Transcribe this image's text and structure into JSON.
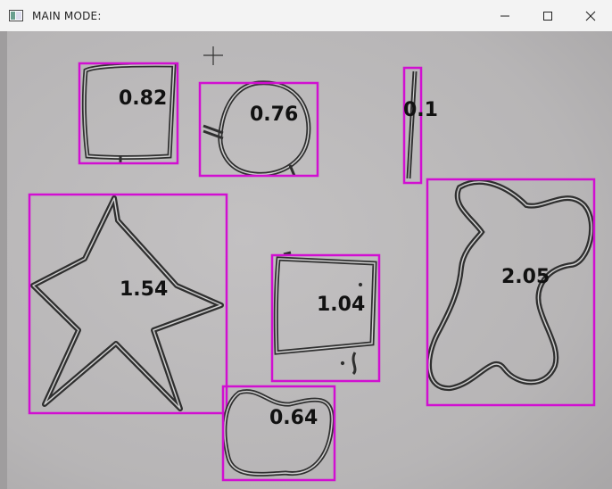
{
  "window": {
    "title": "MAIN MODE:"
  },
  "icons": {
    "app": "app-window-icon",
    "minimize": "minimize-icon",
    "maximize": "maximize-icon",
    "close": "close-icon",
    "cursor": "crosshair-cursor-icon"
  },
  "colors": {
    "box": "#d10fd1",
    "ink": "#2f2f2f",
    "background": "#b9b7b8"
  },
  "detections": [
    {
      "label": "0.82"
    },
    {
      "label": "0.76"
    },
    {
      "label": "0.1"
    },
    {
      "label": "1.54"
    },
    {
      "label": "1.04"
    },
    {
      "label": "2.05"
    },
    {
      "label": "0.64"
    }
  ]
}
